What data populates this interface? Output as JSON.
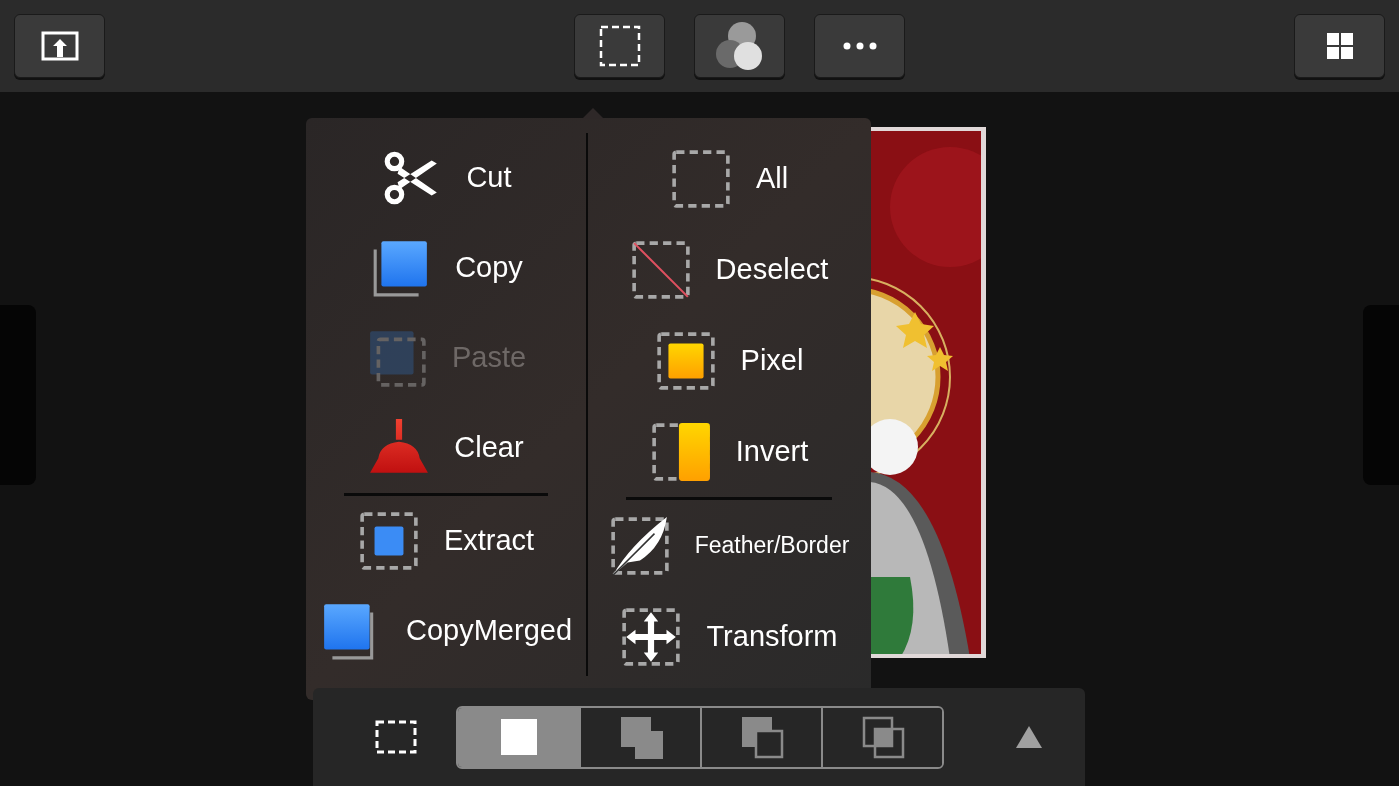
{
  "selection_menu": {
    "columns": [
      {
        "top": [
          {
            "kind": "cut",
            "label": "Cut",
            "disabled": false
          },
          {
            "kind": "copy",
            "label": "Copy",
            "disabled": false
          },
          {
            "kind": "paste",
            "label": "Paste",
            "disabled": true
          },
          {
            "kind": "clear",
            "label": "Clear",
            "disabled": false
          }
        ],
        "bottom": [
          {
            "kind": "extract",
            "label": "Extract",
            "disabled": false
          },
          {
            "kind": "copymerged",
            "label": "CopyMerged",
            "disabled": false
          }
        ]
      },
      {
        "top": [
          {
            "kind": "all",
            "label": "All",
            "disabled": false
          },
          {
            "kind": "deselect",
            "label": "Deselect",
            "disabled": false
          },
          {
            "kind": "pixel",
            "label": "Pixel",
            "disabled": false
          },
          {
            "kind": "invert",
            "label": "Invert",
            "disabled": false
          }
        ],
        "bottom": [
          {
            "kind": "feather",
            "label": "Feather/Border",
            "disabled": false
          },
          {
            "kind": "transform",
            "label": "Transform",
            "disabled": false
          }
        ]
      }
    ]
  },
  "selection_modes": [
    {
      "kind": "new",
      "selected": true
    },
    {
      "kind": "add",
      "selected": false
    },
    {
      "kind": "subtract",
      "selected": false
    },
    {
      "kind": "intersect",
      "selected": false
    }
  ]
}
